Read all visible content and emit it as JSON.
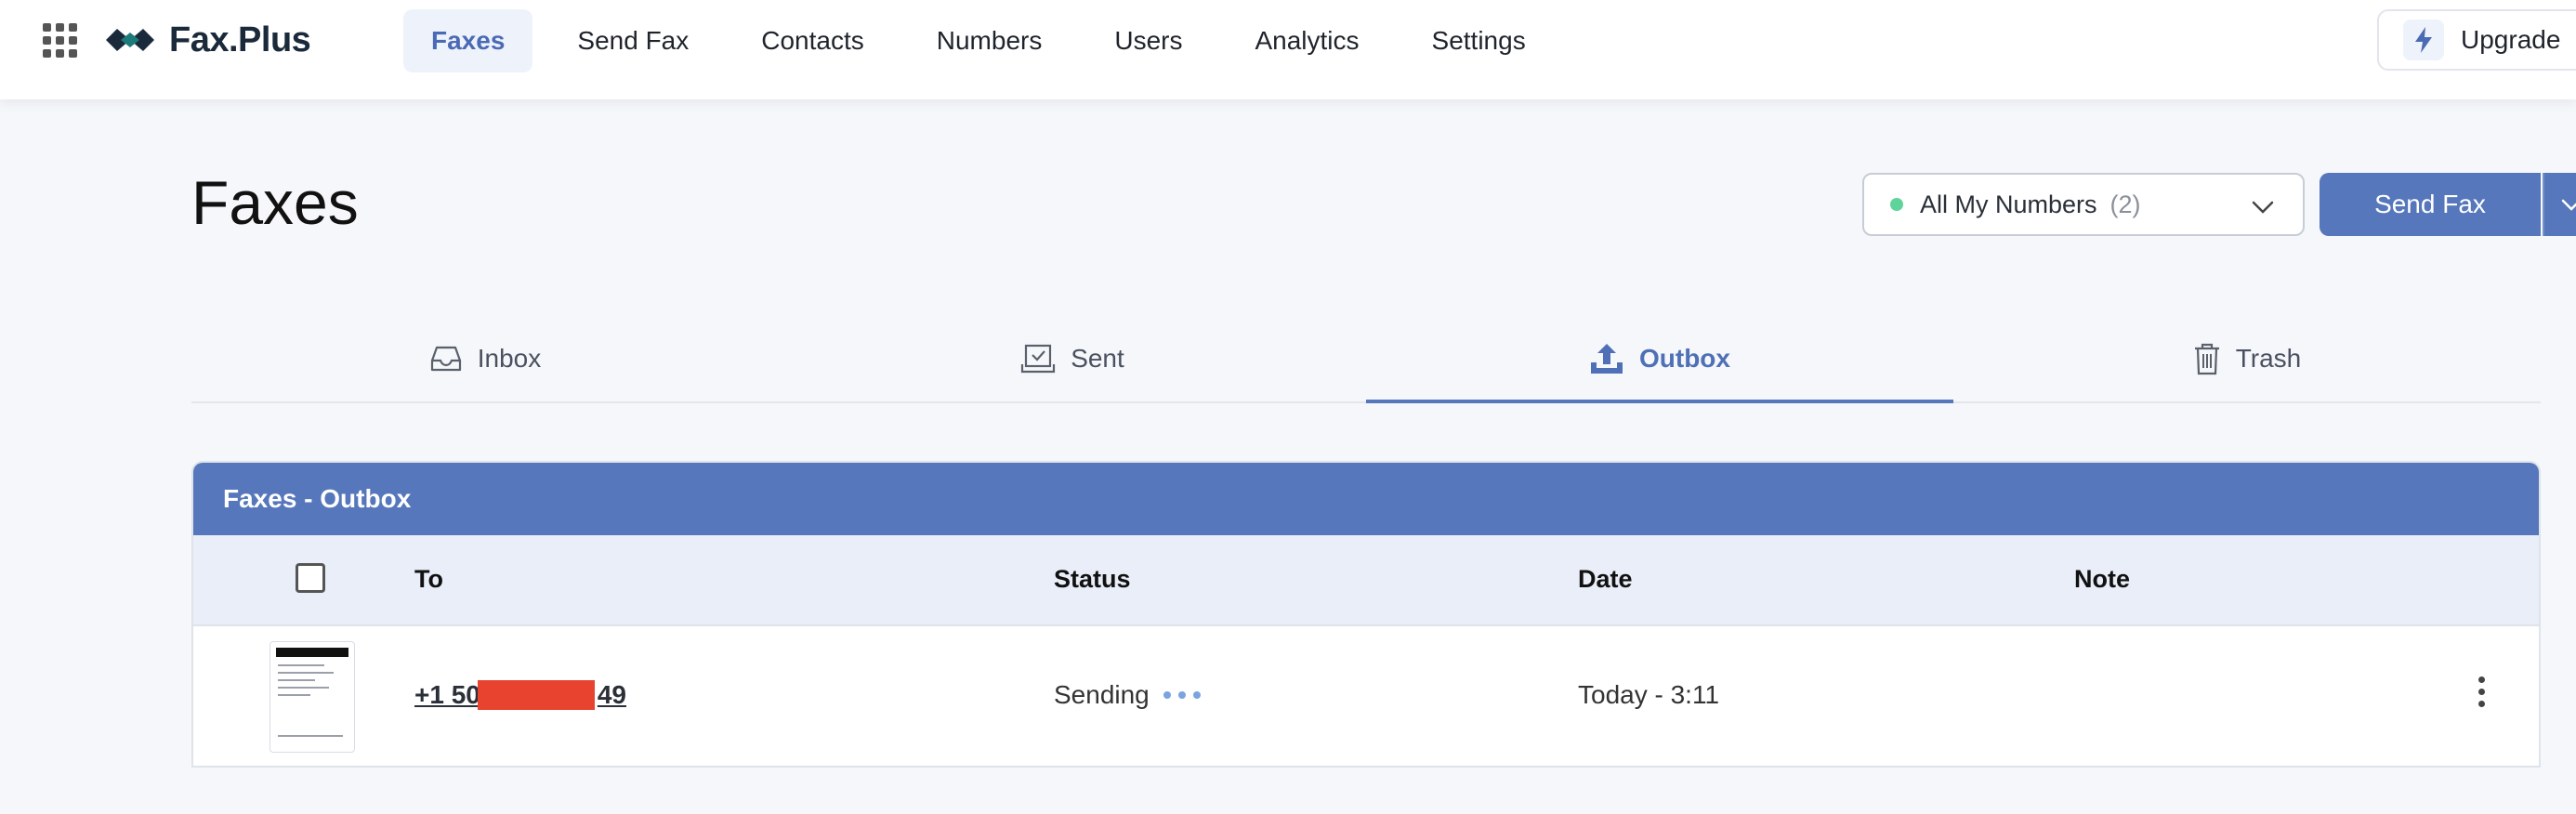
{
  "app": {
    "name": "Fax.Plus"
  },
  "nav": {
    "items": [
      {
        "label": "Faxes",
        "active": true
      },
      {
        "label": "Send Fax",
        "active": false
      },
      {
        "label": "Contacts",
        "active": false
      },
      {
        "label": "Numbers",
        "active": false
      },
      {
        "label": "Users",
        "active": false
      },
      {
        "label": "Analytics",
        "active": false
      },
      {
        "label": "Settings",
        "active": false
      }
    ],
    "upgrade_label": "Upgrade"
  },
  "page": {
    "title": "Faxes"
  },
  "numbers_select": {
    "label": "All My Numbers",
    "count": "(2)"
  },
  "send_fax": {
    "label": "Send Fax"
  },
  "tabs": [
    {
      "label": "Inbox",
      "icon": "inbox-icon"
    },
    {
      "label": "Sent",
      "icon": "sent-icon"
    },
    {
      "label": "Outbox",
      "icon": "upload-icon",
      "active": true
    },
    {
      "label": "Trash",
      "icon": "trash-icon"
    }
  ],
  "table": {
    "title": "Faxes - Outbox",
    "columns": {
      "to": "To",
      "status": "Status",
      "date": "Date",
      "note": "Note"
    },
    "rows": [
      {
        "to_start": "+1 50",
        "to_end": "49",
        "status": "Sending",
        "date": "Today - 3:11",
        "note": ""
      }
    ]
  },
  "colors": {
    "accent": "#5677bb",
    "status_dot": "#5fd49a",
    "redaction": "#e8432e"
  }
}
